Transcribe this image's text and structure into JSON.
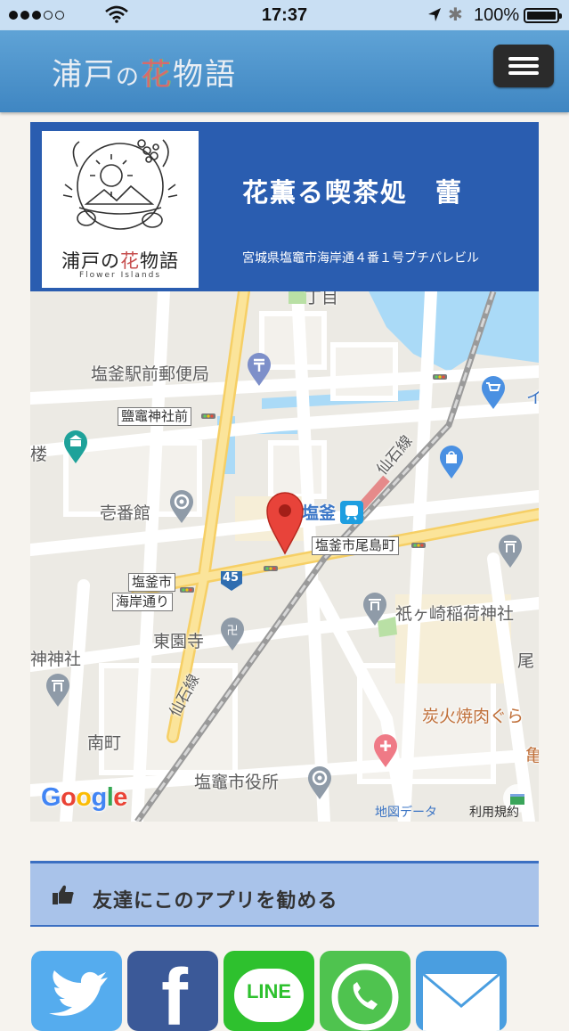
{
  "status_bar": {
    "time": "17:37",
    "battery": "100%",
    "battery_level": 1.0,
    "signal_bars": 3,
    "signal_total": 5
  },
  "header": {
    "title_part1": "浦戸",
    "title_part2": "の",
    "title_part3": "花",
    "title_part4": "物語",
    "menu_icon": "hamburger-icon"
  },
  "store": {
    "logo_text_part1": "浦戸の",
    "logo_text_part2": "花",
    "logo_text_part3": "物語",
    "logo_subtitle": "Flower Islands",
    "name": "花薫る喫茶処　蕾",
    "address": "宮城県塩竈市海岸通４番１号ブチパレビル"
  },
  "map": {
    "labels": {
      "post_office": "塩釜駅前郵便局",
      "shrine_front": "鹽竈神社前",
      "ichibankan": "壱番館",
      "station": "塩釜",
      "onoshima": "塩釜市尾島町",
      "kaigan_1": "塩釜市",
      "kaigan_2": "海岸通り",
      "toenji": "東園寺",
      "inari": "祇ヶ崎稲荷神社",
      "jinja": "神神社",
      "minamimachi": "南町",
      "city_hall": "塩竈市役所",
      "yakiniku": "炭火焼肉ぐら",
      "senseki_1": "仙石線",
      "senseki_2": "仙石線",
      "route": "45",
      "chome": "丁目",
      "partial_ro": "楼",
      "partial_o": "尾",
      "partial_kame": "亀",
      "partial_i": "イ"
    },
    "google_letters": [
      "G",
      "o",
      "o",
      "g",
      "l",
      "e"
    ],
    "google_colors": [
      "#4285f4",
      "#ea4335",
      "#fbbc05",
      "#4285f4",
      "#34a853",
      "#ea4335"
    ],
    "map_data_link": "地図データ",
    "terms_link": "利用規約"
  },
  "recommend": {
    "label": "友達にこのアプリを勧める",
    "icon": "thumbs-up-icon"
  },
  "share": {
    "twitter_color": "#55acee",
    "facebook_color": "#3b5998",
    "facebook_glyph": "f",
    "line_color": "#2ec12e",
    "line_label": "LINE",
    "whatsapp_color": "#4fc34f",
    "mail_color": "#4a9ee0"
  }
}
